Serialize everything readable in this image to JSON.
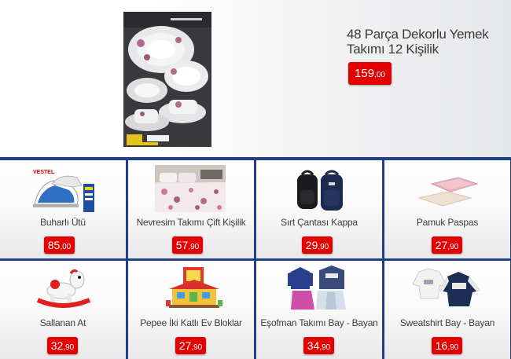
{
  "featured": {
    "title_line1": "48 Parça Dekorlu Yemek",
    "title_line2": "Takımı 12 Kişilik",
    "price_int": "159",
    "price_dec": ",00",
    "image_icon": "dinner-set-box-image"
  },
  "products": [
    {
      "name": "Buharlı Ütü",
      "price_int": "85",
      "price_dec": ",00",
      "icon": "steam-iron-image"
    },
    {
      "name": "Nevresim Takımı Çift Kişilik",
      "price_int": "57",
      "price_dec": ",90",
      "icon": "bedding-set-image"
    },
    {
      "name": "Sırt Çantası Kappa",
      "price_int": "29",
      "price_dec": ",90",
      "icon": "backpack-image"
    },
    {
      "name": "Pamuk Paspas",
      "price_int": "27",
      "price_dec": ",90",
      "icon": "bath-mat-image"
    },
    {
      "name": "Sallanan At",
      "price_int": "32",
      "price_dec": ",90",
      "icon": "rocking-horse-image"
    },
    {
      "name": "Pepee İki Katlı Ev Bloklar",
      "price_int": "27",
      "price_dec": ",90",
      "icon": "toy-house-blocks-image"
    },
    {
      "name": "Eşofman Takımı Bay - Bayan",
      "price_int": "34",
      "price_dec": ",90",
      "icon": "tracksuit-image"
    },
    {
      "name": "Sweatshirt Bay - Bayan",
      "price_int": "16",
      "price_dec": ",90",
      "icon": "sweatshirt-image"
    }
  ],
  "colors": {
    "price_badge": "#e40000",
    "grid_border": "#1f3f8a",
    "text": "#3a3a3a"
  }
}
